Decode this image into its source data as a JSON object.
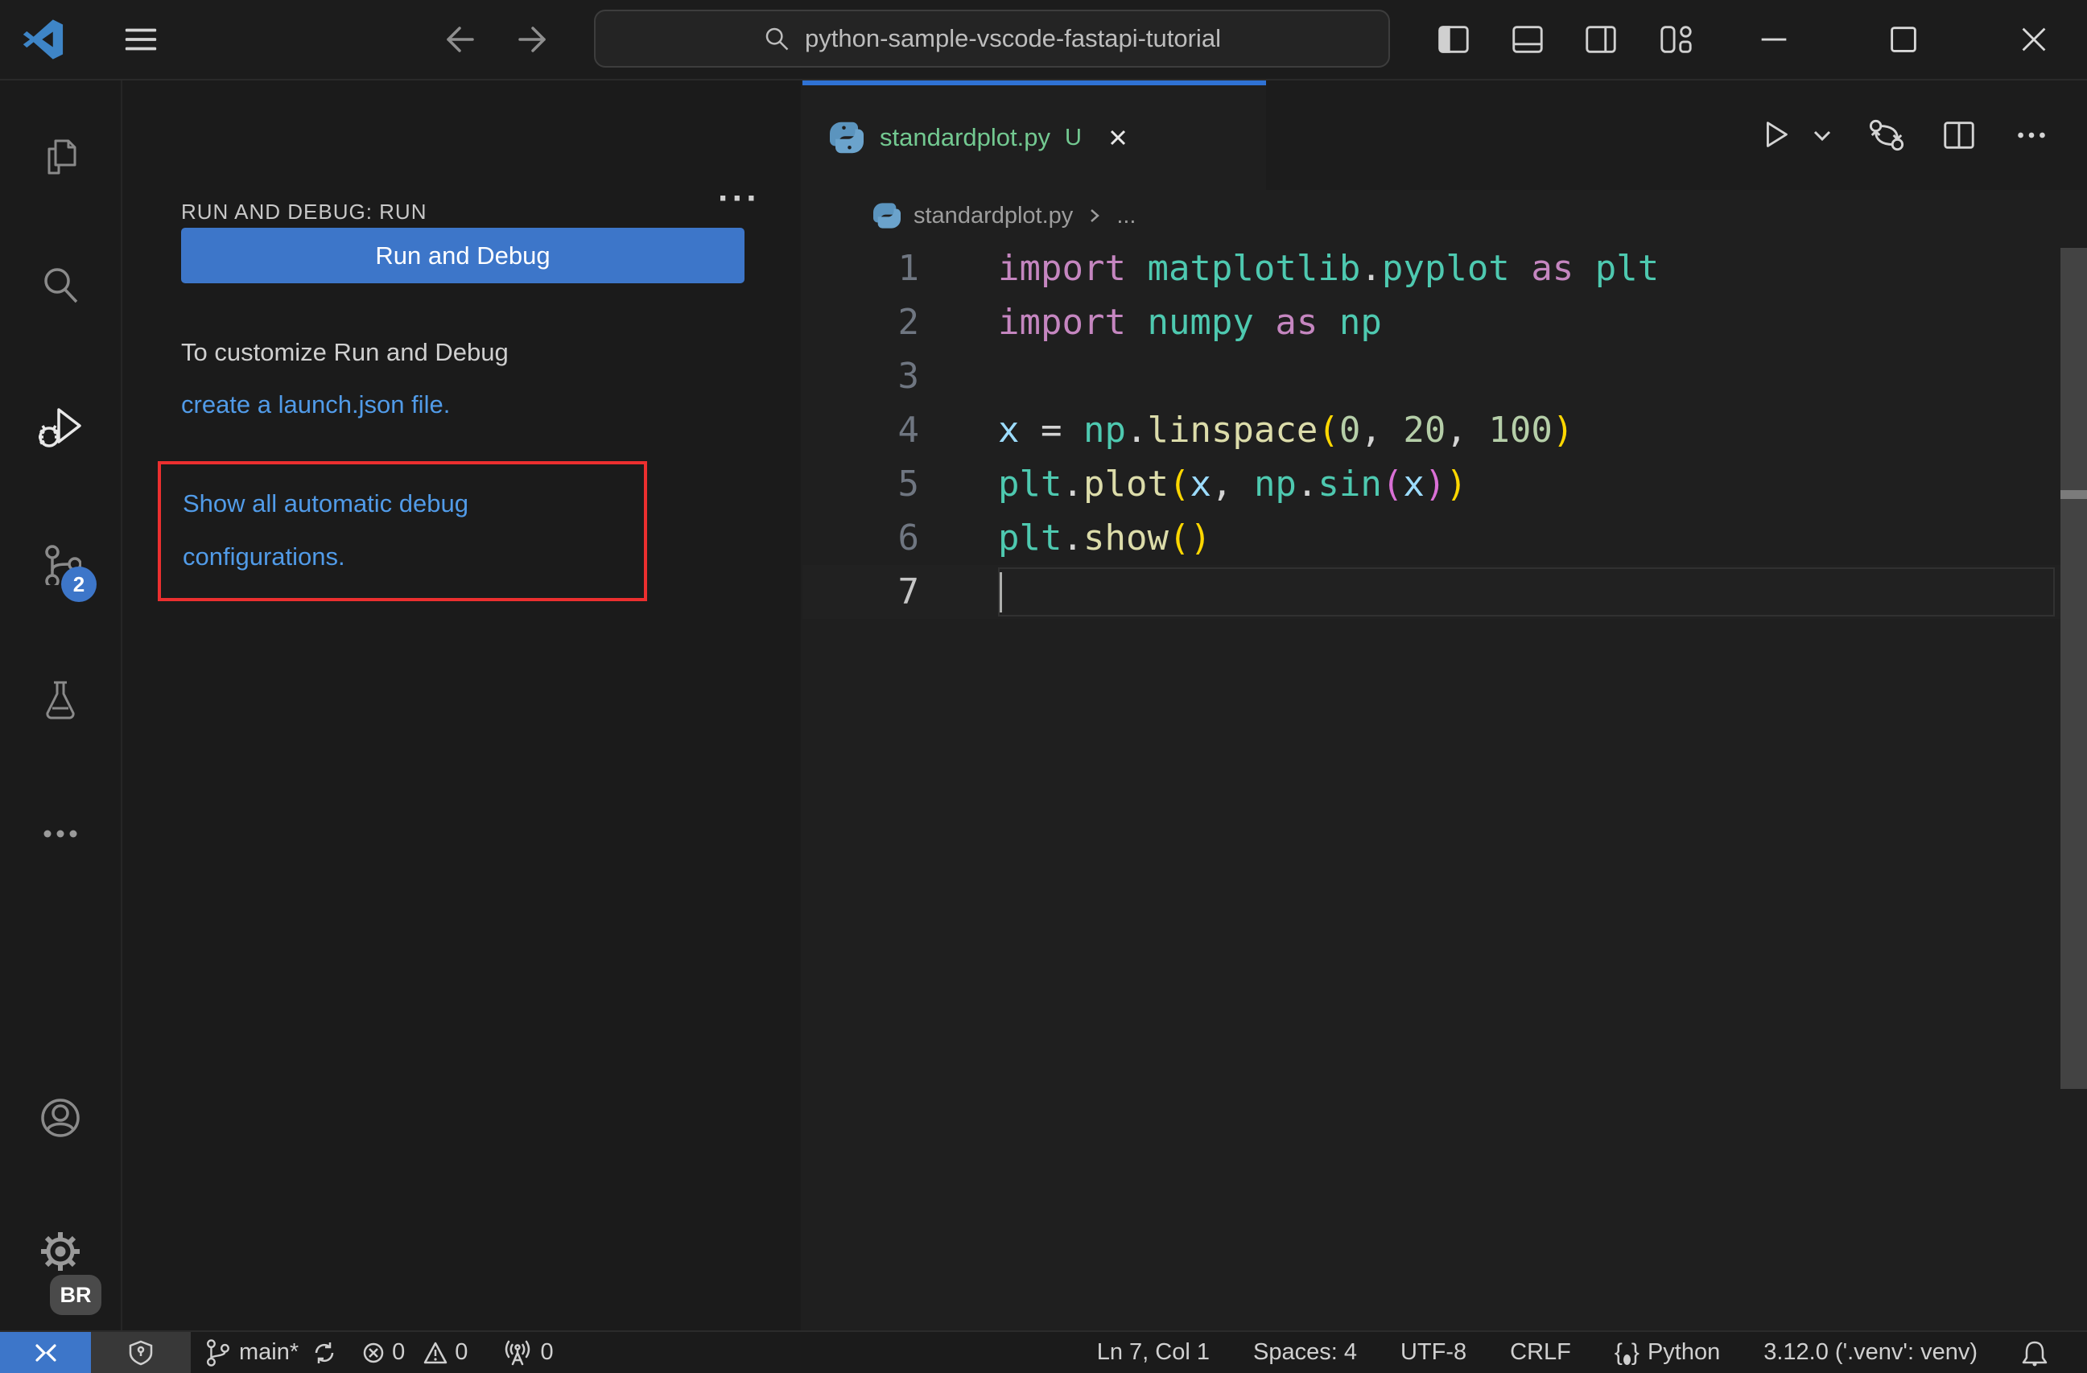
{
  "colors": {
    "accent_blue": "#3D76C9",
    "tab_accent_blue": "#2F72D4",
    "link_blue": "#519BE8",
    "modified_file_green": "#73C991",
    "annotation_red": "#EC2F2F",
    "scrollbar_gray": "#434343"
  },
  "icons": {
    "explorer": "overlapping-files",
    "search": "magnifier",
    "run_and_debug": "play-triangle-with-bug",
    "source_control": "branch-nodes",
    "testing": "beaker",
    "more": "ellipsis",
    "accounts": "person-circle",
    "settings": "gear",
    "remote": "><",
    "branch": "git-branch",
    "sync": "circular-arrows",
    "errors": "circle-x",
    "warnings": "triangle-exclamation",
    "ports": "radio-tower",
    "language_mode": "curly-braces",
    "notifications": "bell",
    "window_controls": "minimize maximize close",
    "layout_controls": "toggle-sidebar toggle-panel toggle-secondary-sidebar customize-layout"
  },
  "title_bar": {
    "command_center_text": "python-sample-vscode-fastapi-tutorial"
  },
  "activity_bar": {
    "source_control_badge": "2",
    "settings_badge": "BR"
  },
  "sidebar": {
    "title": "RUN AND DEBUG: RUN",
    "more_actions": "···",
    "run_button_label": "Run and Debug",
    "customize_text": "To customize Run and Debug",
    "launch_json_link": "create a launch.json file.",
    "show_configs_link": "Show all automatic debug configurations."
  },
  "editor": {
    "tab": {
      "label": "standardplot.py",
      "modified_indicator": "U"
    },
    "breadcrumb": {
      "file": "standardplot.py",
      "symbol_more": "..."
    },
    "code": {
      "token_colors": {
        "kw": "#C586C0",
        "mod": "#4EC9B0",
        "fn": "#DCDCAA",
        "var": "#9CDCFE",
        "num": "#B5CEA8",
        "fg": "#D4D4D4",
        "b1": "#FFD700",
        "b2": "#DA70D6"
      },
      "lines": [
        {
          "n": 1,
          "tokens": [
            [
              "import",
              "kw"
            ],
            [
              " ",
              "fg"
            ],
            [
              "matplotlib",
              "mod"
            ],
            [
              ".",
              "fg"
            ],
            [
              "pyplot",
              "mod"
            ],
            [
              " ",
              "fg"
            ],
            [
              "as",
              "kw"
            ],
            [
              " ",
              "fg"
            ],
            [
              "plt",
              "mod"
            ]
          ]
        },
        {
          "n": 2,
          "tokens": [
            [
              "import",
              "kw"
            ],
            [
              " ",
              "fg"
            ],
            [
              "numpy",
              "mod"
            ],
            [
              " ",
              "fg"
            ],
            [
              "as",
              "kw"
            ],
            [
              " ",
              "fg"
            ],
            [
              "np",
              "mod"
            ]
          ]
        },
        {
          "n": 3,
          "tokens": []
        },
        {
          "n": 4,
          "tokens": [
            [
              "x",
              "var"
            ],
            [
              " = ",
              "fg"
            ],
            [
              "np",
              "mod"
            ],
            [
              ".",
              "fg"
            ],
            [
              "linspace",
              "fn"
            ],
            [
              "(",
              "b1"
            ],
            [
              "0",
              "num"
            ],
            [
              ", ",
              "fg"
            ],
            [
              "20",
              "num"
            ],
            [
              ", ",
              "fg"
            ],
            [
              "100",
              "num"
            ],
            [
              ")",
              "b1"
            ]
          ]
        },
        {
          "n": 5,
          "tokens": [
            [
              "plt",
              "mod"
            ],
            [
              ".",
              "fg"
            ],
            [
              "plot",
              "fn"
            ],
            [
              "(",
              "b1"
            ],
            [
              "x",
              "var"
            ],
            [
              ", ",
              "fg"
            ],
            [
              "np",
              "mod"
            ],
            [
              ".",
              "fg"
            ],
            [
              "sin",
              "mod"
            ],
            [
              "(",
              "b2"
            ],
            [
              "x",
              "var"
            ],
            [
              ")",
              "b2"
            ],
            [
              ")",
              "b1"
            ]
          ]
        },
        {
          "n": 6,
          "tokens": [
            [
              "plt",
              "mod"
            ],
            [
              ".",
              "fg"
            ],
            [
              "show",
              "fn"
            ],
            [
              "(",
              "b1"
            ],
            [
              ")",
              "b1"
            ]
          ]
        },
        {
          "n": 7,
          "tokens": [],
          "current": true
        }
      ]
    }
  },
  "status_bar": {
    "branch": "main*",
    "errors": "0",
    "warnings": "0",
    "ports": "0",
    "line_col": "Ln 7, Col 1",
    "indentation": "Spaces: 4",
    "encoding": "UTF-8",
    "eol": "CRLF",
    "language": "Python",
    "interpreter": "3.12.0 ('.venv': venv)"
  }
}
